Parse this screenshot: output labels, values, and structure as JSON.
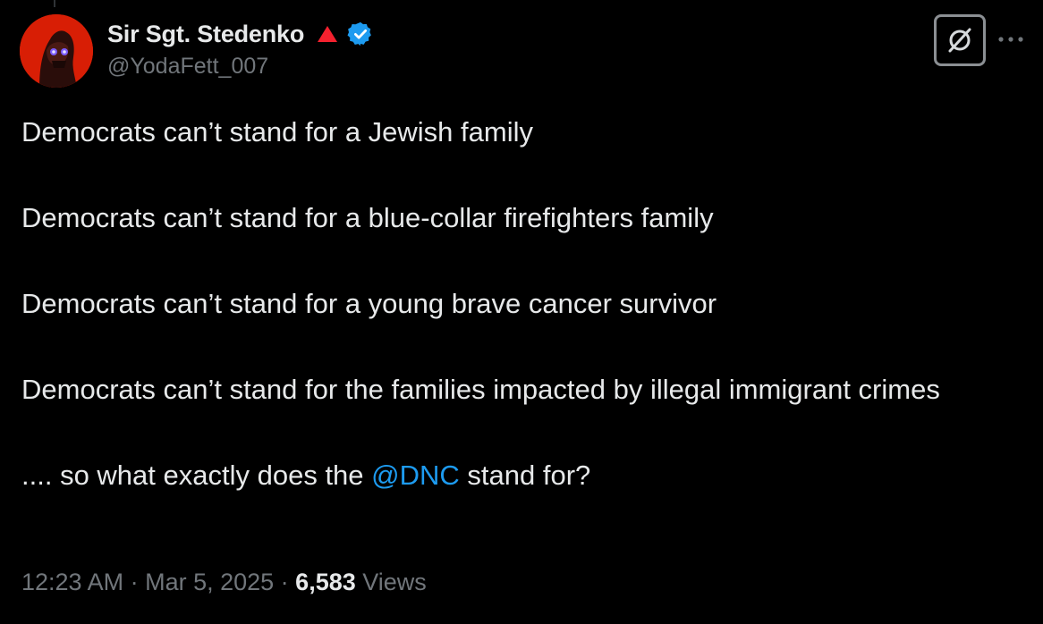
{
  "author": {
    "display_name": "Sir Sgt. Stedenko",
    "handle": "@YodaFett_007",
    "avatar_icon": "avatar-icon",
    "badge_icons": [
      "red-triangle-icon",
      "verified-badge-icon"
    ]
  },
  "actions": {
    "grok_icon": "grok-icon",
    "more_icon": "more-icon"
  },
  "tweet": {
    "lines": [
      "Democrats can’t stand for a Jewish family",
      "Democrats can’t stand for a blue-collar firefighters family",
      "Democrats can’t stand for a young brave cancer survivor",
      "Democrats can’t stand for the families impacted by illegal immigrant crimes"
    ],
    "closing_prefix": ".... so what exactly does the ",
    "mention": "@DNC",
    "closing_suffix": " stand for?"
  },
  "meta": {
    "time": "12:23 AM",
    "separator": " · ",
    "date": "Mar 5, 2025",
    "views_count": "6,583",
    "views_label": " Views"
  },
  "colors": {
    "background": "#000000",
    "text": "#e7e9ea",
    "secondary": "#71767b",
    "link": "#1d9bf0",
    "verified": "#1d9bf0",
    "triangle": "#f4212e"
  }
}
